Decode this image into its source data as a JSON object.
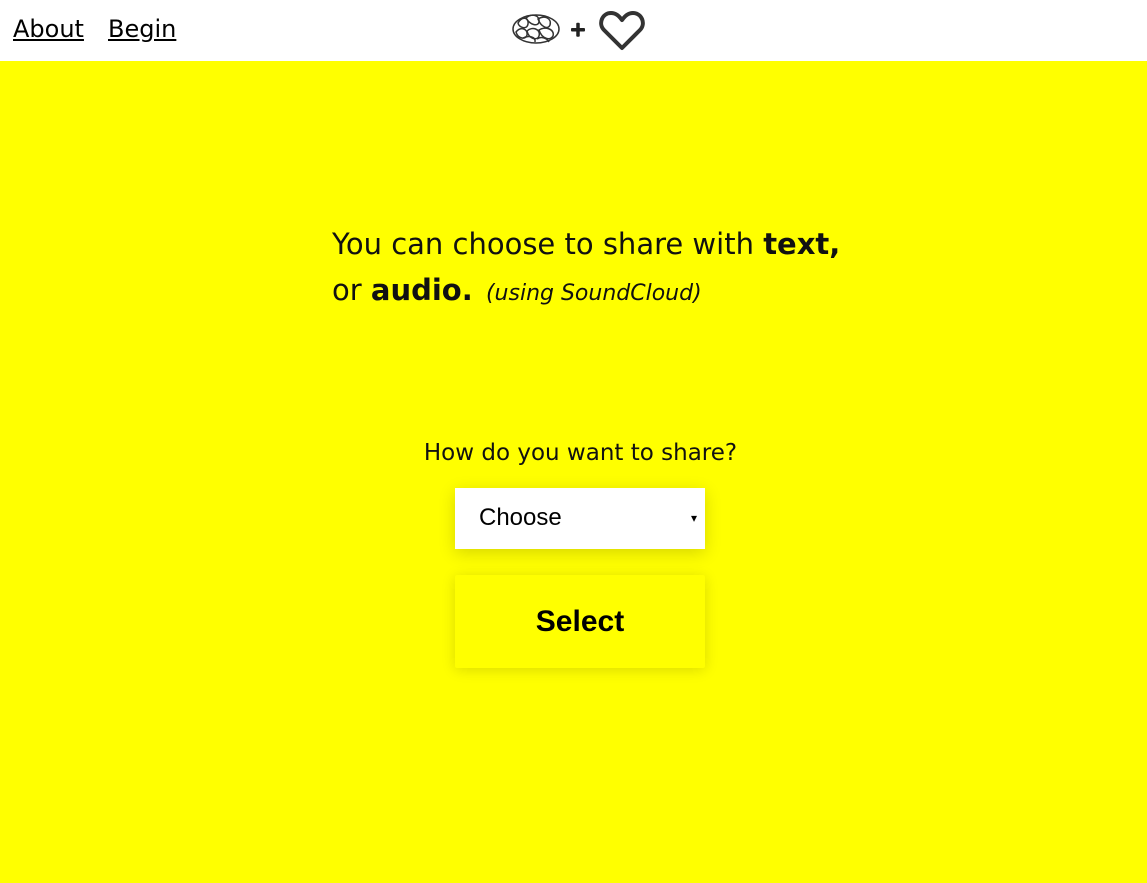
{
  "nav": {
    "about": "About",
    "begin": "Begin"
  },
  "logo": {
    "plus": "+",
    "brain_icon": "brain-icon",
    "heart_icon": "heart-icon"
  },
  "intro": {
    "line1_prefix": "You can choose to share with ",
    "line1_strong": "text,",
    "line2_prefix": "or ",
    "line2_strong": "audio.",
    "note": "(using SoundCloud)"
  },
  "form": {
    "question": "How do you want to share?",
    "selected_value": "Choose",
    "dropdown_arrow": "▾",
    "submit_label": "Select"
  },
  "colors": {
    "background": "#ffff00",
    "header": "#ffffff",
    "text": "#000000"
  }
}
